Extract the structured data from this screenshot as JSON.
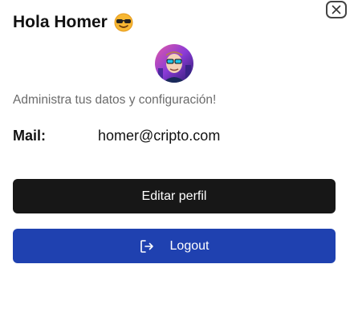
{
  "header": {
    "greeting": "Hola Homer",
    "emoji_icon": "sunglasses-face-icon"
  },
  "close_icon": "close-icon",
  "avatar": {
    "icon": "user-avatar"
  },
  "subtitle": "Administra tus datos y configuración!",
  "mail": {
    "label": "Mail:",
    "value": "homer@cripto.com"
  },
  "buttons": {
    "edit_label": "Editar perfil",
    "logout_label": "Logout",
    "logout_icon": "logout-icon"
  },
  "colors": {
    "edit_button": "#171717",
    "logout_button": "#1f41b0",
    "subtitle_text": "#6b6b6b"
  }
}
